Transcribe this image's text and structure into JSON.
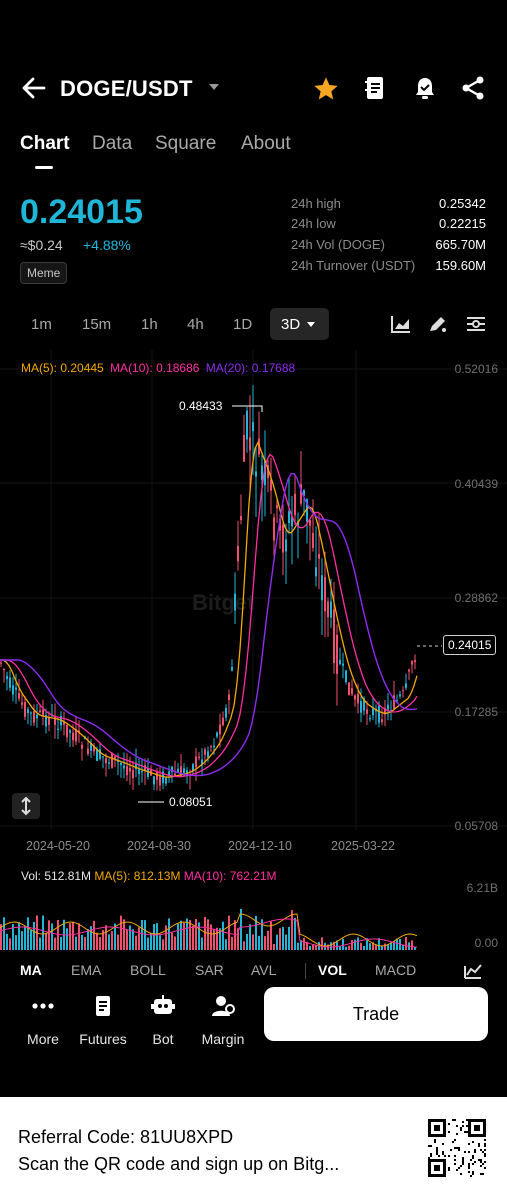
{
  "header": {
    "pair": "DOGE/USDT"
  },
  "tabs": [
    {
      "label": "Chart",
      "active": true
    },
    {
      "label": "Data",
      "active": false
    },
    {
      "label": "Square",
      "active": false
    },
    {
      "label": "About",
      "active": false
    }
  ],
  "ticker": {
    "last_price": "0.24015",
    "fiat_price": "≈$0.24",
    "change": "+4.88%",
    "tag": "Meme",
    "stats": [
      {
        "label": "24h high",
        "value": "0.25342"
      },
      {
        "label": "24h low",
        "value": "0.22215"
      },
      {
        "label": "24h Vol (DOGE)",
        "value": "665.70M"
      },
      {
        "label": "24h Turnover (USDT)",
        "value": "159.60M"
      }
    ]
  },
  "intervals": [
    "1m",
    "15m",
    "1h",
    "4h",
    "1D",
    "3D"
  ],
  "selected_interval": "3D",
  "chart": {
    "ma_legend": {
      "ma5": "MA(5): 0.20445",
      "ma10": "MA(10): 0.18686",
      "ma20": "MA(20): 0.17688"
    },
    "y_ticks": [
      "0.52016",
      "0.40439",
      "0.28862",
      "0.17285",
      "0.05708"
    ],
    "x_ticks": [
      "2024-05-20",
      "2024-08-30",
      "2024-12-10",
      "2025-03-22"
    ],
    "current_price": "0.24015",
    "high_marker": "0.48433",
    "low_marker": "0.08051",
    "watermark": "Bitget",
    "colors": {
      "up": "#1fb6d8",
      "down": "#f0506e",
      "ma5": "#f2a900",
      "ma10": "#ff2fa3",
      "ma20": "#8d2cf0"
    }
  },
  "volume": {
    "legend": {
      "vol": "Vol: 512.81M",
      "ma5": "MA(5): 812.13M",
      "ma10": "MA(10): 762.21M"
    },
    "y_ticks": [
      "6.21B",
      "0.00"
    ]
  },
  "indicators": {
    "main": [
      "MA",
      "EMA",
      "BOLL",
      "SAR",
      "AVL"
    ],
    "sub": [
      "VOL",
      "MACD"
    ]
  },
  "bottom_nav": {
    "items": [
      {
        "label": "More",
        "icon": "more-icon"
      },
      {
        "label": "Futures",
        "icon": "futures-icon"
      },
      {
        "label": "Bot",
        "icon": "bot-icon"
      },
      {
        "label": "Margin",
        "icon": "margin-icon"
      }
    ],
    "trade_label": "Trade"
  },
  "footer": {
    "referral": "Referral Code: 81UU8XPD",
    "scan_text": "Scan the QR code and sign up on Bitg..."
  }
}
